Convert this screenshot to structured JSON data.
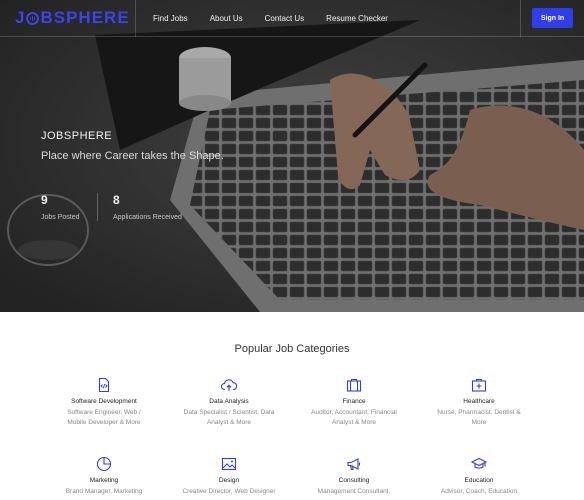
{
  "brand": {
    "logo_pre": "J",
    "logo_post": "BSPHERE",
    "accent": "#2f3ee6"
  },
  "nav": {
    "links": [
      "Find Jobs",
      "About Us",
      "Contact Us",
      "Resume Checker"
    ],
    "signin": "Sign In"
  },
  "hero": {
    "title": "JOBSPHERE",
    "subtitle": "Place where Career takes the Shape.",
    "stats": [
      {
        "value": "9",
        "label": "Jobs Posted"
      },
      {
        "value": "8",
        "label": "Applications Received"
      }
    ]
  },
  "categories": {
    "heading": "Popular Job Categories",
    "items": [
      {
        "icon": "code-file-icon",
        "name": "Software Development",
        "desc1": "Software Engineer, Web /",
        "desc2": "Mobile Developer & More"
      },
      {
        "icon": "cloud-upload-icon",
        "name": "Data Analysis",
        "desc1": "Data Specialist / Scientist, Data",
        "desc2": "Analyst & More"
      },
      {
        "icon": "briefcase-icon",
        "name": "Finance",
        "desc1": "Auditor, Accountant, Financial",
        "desc2": "Analyst & More"
      },
      {
        "icon": "first-aid-icon",
        "name": "Healthcare",
        "desc1": "Nurse, Pharmacist, Dentist &",
        "desc2": "More"
      },
      {
        "icon": "pie-chart-icon",
        "name": "Marketing",
        "desc1": "Brand Manager, Marketing",
        "desc2": ""
      },
      {
        "icon": "image-icon",
        "name": "Design",
        "desc1": "Creative Director, Web Designer",
        "desc2": ""
      },
      {
        "icon": "megaphone-icon",
        "name": "Consulting",
        "desc1": "Management Consultant,",
        "desc2": ""
      },
      {
        "icon": "graduation-cap-icon",
        "name": "Education",
        "desc1": "Advisor, Coach, Education",
        "desc2": ""
      }
    ]
  }
}
